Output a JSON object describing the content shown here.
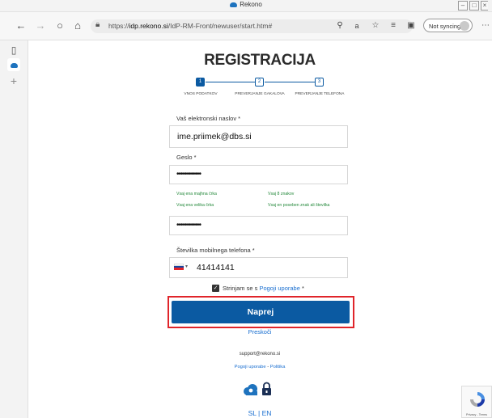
{
  "browser": {
    "window_title": "Rekono",
    "url_prefix": "https://",
    "url_host": "idp.rekono.si",
    "url_path": "/IdP-RM-Front/newuser/start.htm#",
    "sync_label": "Not syncing"
  },
  "form": {
    "title": "REGISTRACIJA",
    "steps": [
      {
        "num": "1",
        "label": "VNOS PODATKOV"
      },
      {
        "num": "2",
        "label": "PREVERJANJE GAKALOVA"
      },
      {
        "num": "3",
        "label": "PREVERJANJE TELEFONA"
      }
    ],
    "email_label": "Vaš elektronski naslov *",
    "email_value": "ime.priimek@dbs.si",
    "password_label": "Geslo *",
    "password_value": "••••••••••••",
    "password_repeat_value": "••••••••••••",
    "hints": {
      "lowercase": "Vsaj ena majhna črka",
      "length": "Vsaj 8 znakov",
      "uppercase": "Vsaj ena velika črka",
      "special": "Vsaj en poseben znak ali številka"
    },
    "phone_label": "Številka mobilnega telefona *",
    "phone_value": "41414141",
    "agree_prefix": "Strinjam se s ",
    "agree_link": "Pogoji uporabe",
    "agree_suffix": " *",
    "next_button": "Naprej",
    "skip_link": "Preskoči"
  },
  "footer": {
    "support_email": "support@rekono.si",
    "terms_link": "Pogoji uporabe",
    "separator": " - ",
    "policy_link": "Politika",
    "lang_sl": "SL",
    "lang_sep": " | ",
    "lang_en": "EN",
    "recaptcha_text": "Privacy - Terms"
  },
  "colors": {
    "primary": "#0b5aa2",
    "link": "#1a6fd0",
    "hint_green": "#23883a",
    "highlight_red": "#e0242a"
  }
}
